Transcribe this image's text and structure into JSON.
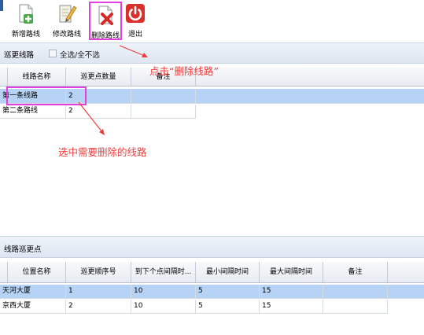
{
  "toolbar": {
    "buttons": [
      {
        "label": "新增路线",
        "icon": "add-document-icon"
      },
      {
        "label": "修改路线",
        "icon": "edit-document-icon"
      },
      {
        "label": "删除路线",
        "icon": "delete-document-icon"
      },
      {
        "label": "退出",
        "icon": "power-icon"
      }
    ]
  },
  "routes_section": {
    "title": "巡更线路",
    "select_all_label": "全选/全不选",
    "columns": [
      "线路名称",
      "巡更点数量",
      "备注"
    ],
    "rows": [
      {
        "name": "第一条线路",
        "count": "2",
        "note": ""
      },
      {
        "name": "第二条路线",
        "count": "2",
        "note": ""
      }
    ]
  },
  "points_section": {
    "title": "线路巡更点",
    "columns": [
      "位置名称",
      "巡更顺序号",
      "到下个点间隔时...",
      "最小间隔时间",
      "最大间隔时间",
      "备注"
    ],
    "rows": [
      {
        "location": "天河大厦",
        "order": "1",
        "interval": "10",
        "min": "5",
        "max": "15",
        "note": ""
      },
      {
        "location": "京西大厦",
        "order": "2",
        "interval": "10",
        "min": "5",
        "max": "15",
        "note": ""
      }
    ]
  },
  "annotations": {
    "click_delete": "点击“删除线路”",
    "select_route": "选中需要删除的线路"
  },
  "colors": {
    "highlight": "#e23ee0",
    "annotation": "#f03c3c",
    "selected_row": "#b6d3f5"
  }
}
